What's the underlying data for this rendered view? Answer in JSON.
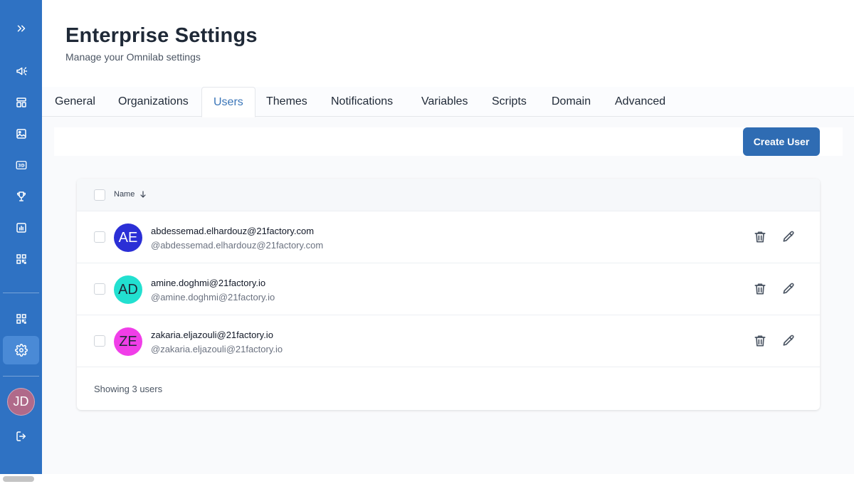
{
  "header": {
    "title": "Enterprise Settings",
    "subtitle": "Manage your Omnilab settings"
  },
  "sidebar": {
    "items": [
      {
        "icon": "chevrons-right-icon"
      },
      {
        "icon": "megaphone-icon"
      },
      {
        "icon": "layout-icon"
      },
      {
        "icon": "image-icon"
      },
      {
        "icon": "3d-icon"
      },
      {
        "icon": "trophy-icon"
      },
      {
        "icon": "chart-icon"
      },
      {
        "icon": "qr-code-icon"
      },
      {
        "icon": "qr-code-icon"
      },
      {
        "icon": "gear-icon",
        "active": true
      },
      {
        "icon": "logout-icon"
      }
    ],
    "avatar_initials": "JD"
  },
  "tabs": [
    {
      "label": "General"
    },
    {
      "label": "Organizations"
    },
    {
      "label": "Users",
      "active": true
    },
    {
      "label": "Themes"
    },
    {
      "label": "Notifications"
    },
    {
      "label": "Variables"
    },
    {
      "label": "Scripts"
    },
    {
      "label": "Domain"
    },
    {
      "label": "Advanced"
    }
  ],
  "toolbar": {
    "create_label": "Create User"
  },
  "table": {
    "columns": [
      {
        "label": "Name",
        "sort": "descending"
      }
    ],
    "rows": [
      {
        "initials": "AE",
        "email": "abdessemad.elhardouz@21factory.com",
        "handle": "@abdessemad.elhardouz@21factory.com",
        "avatar_color": "#2b2fd6",
        "avatar_text_color": "#ffffff"
      },
      {
        "initials": "AD",
        "email": "amine.doghmi@21factory.io",
        "handle": "@amine.doghmi@21factory.io",
        "avatar_color": "#22e0d0",
        "avatar_text_color": "#1f2937"
      },
      {
        "initials": "ZE",
        "email": "zakaria.eljazouli@21factory.io",
        "handle": "@zakaria.eljazouli@21factory.io",
        "avatar_color": "#f03ee8",
        "avatar_text_color": "#1f2937"
      }
    ],
    "footer": "Showing 3 users"
  },
  "colors": {
    "sidebar": "#2f72c3",
    "accent": "#2f6cb3",
    "active_tab_text": "#3a75b8"
  }
}
